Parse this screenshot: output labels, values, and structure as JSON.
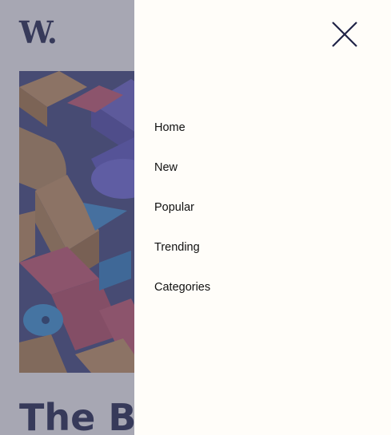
{
  "logo": {
    "text": "W."
  },
  "hero": {
    "title": "The Br"
  },
  "menu": {
    "close_icon": "close-icon",
    "items": [
      {
        "label": "Home"
      },
      {
        "label": "New"
      },
      {
        "label": "Popular"
      },
      {
        "label": "Trending"
      },
      {
        "label": "Categories"
      }
    ]
  },
  "colors": {
    "brand_navy": "#1f2347",
    "background": "#fffdf9",
    "overlay": "rgba(80,82,110,0.5)",
    "menu_text": "#111111"
  }
}
